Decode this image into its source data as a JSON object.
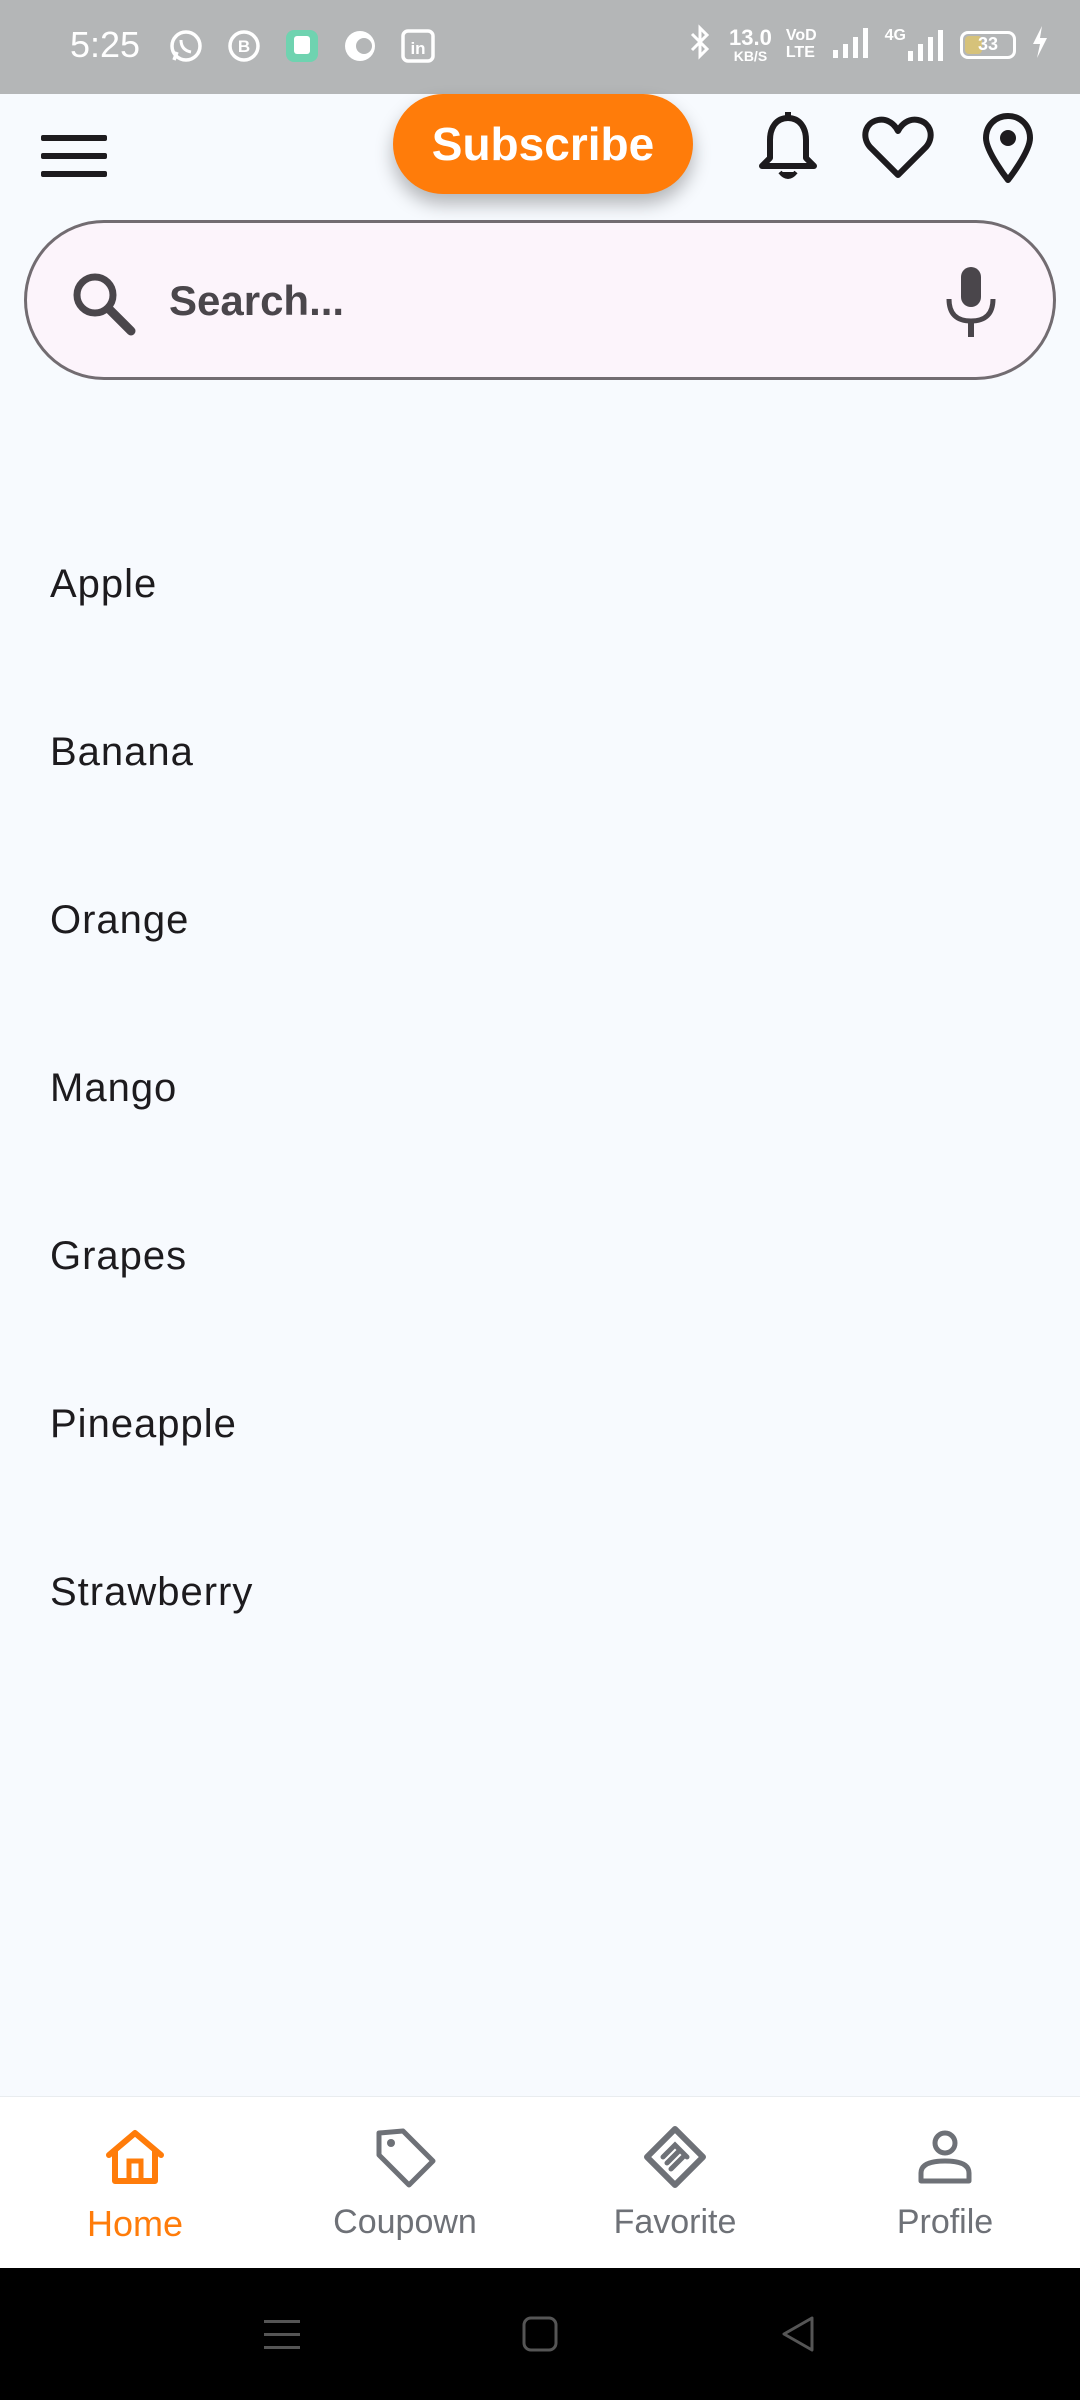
{
  "status_bar": {
    "time": "5:25",
    "left_icons": [
      "whatsapp-icon",
      "whatsapp-business-icon",
      "app-icon",
      "messenger-icon",
      "linkedin-icon"
    ],
    "net_speed": "13.0",
    "net_speed_unit": "KB/S",
    "volte_line1": "VoD",
    "volte_line2": "LTE",
    "network_label": "4G",
    "battery": "33",
    "battery_level": 0.33
  },
  "app_bar": {
    "subscribe_label": "Subscribe",
    "accent_color": "#ff7c0a"
  },
  "search": {
    "placeholder": "Search..."
  },
  "list": {
    "items": [
      "Apple",
      "Banana",
      "Orange",
      "Mango",
      "Grapes",
      "Pineapple",
      "Strawberry"
    ]
  },
  "bottom_nav": {
    "items": [
      {
        "label": "Home",
        "icon": "home-icon",
        "active": true
      },
      {
        "label": "Coupown",
        "icon": "tag-icon",
        "active": false
      },
      {
        "label": "Favorite",
        "icon": "handshake-icon",
        "active": false
      },
      {
        "label": "Profile",
        "icon": "person-icon",
        "active": false
      }
    ]
  }
}
